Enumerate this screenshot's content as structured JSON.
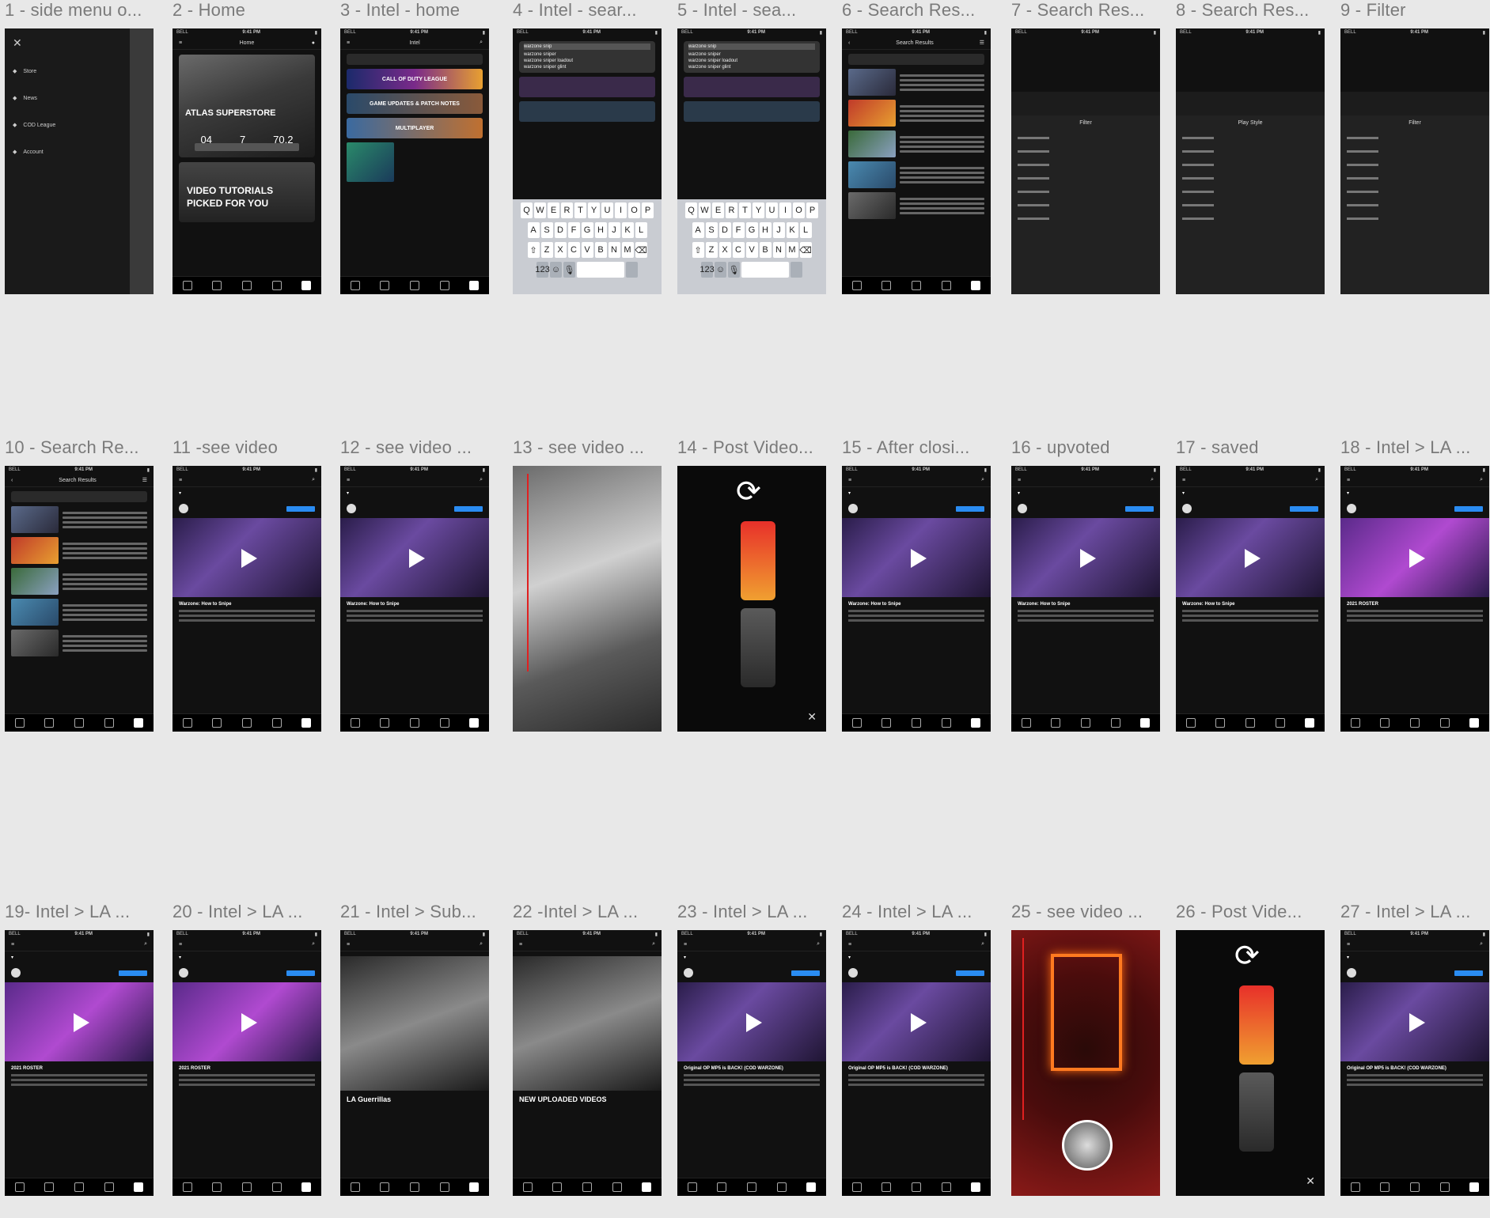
{
  "rows": [
    {
      "frames": [
        {
          "label": "1 - side menu o...",
          "kind": "menu",
          "menu_items": [
            "Store",
            "News",
            "COD League",
            "Account"
          ]
        },
        {
          "label": "2 - Home",
          "kind": "home",
          "title": "Home",
          "hero_title": "ATLAS SUPERSTORE",
          "stats": [
            "04",
            "7",
            "70.2"
          ],
          "card_title": "VIDEO TUTORIALS PICKED FOR YOU"
        },
        {
          "label": "3 - Intel -  home",
          "kind": "intel",
          "title": "Intel",
          "banners": [
            "CALL OF DUTY LEAGUE",
            "GAME UPDATES & PATCH NOTES",
            "MULTIPLAYER"
          ]
        },
        {
          "label": "4 - Intel - sear...",
          "kind": "search",
          "query": "warzone snip",
          "suggestions": [
            "warzone sniper",
            "warzone sniper loadout",
            "warzone sniper glint"
          ]
        },
        {
          "label": "5 -  Intel -  sea...",
          "kind": "search",
          "query": "warzone snip",
          "suggestions": [
            "warzone sniper",
            "warzone sniper loadout",
            "warzone sniper glint"
          ]
        },
        {
          "label": "6 - Search Res...",
          "kind": "results",
          "title": "Search Results"
        },
        {
          "label": "7 - Search Res...",
          "kind": "filter",
          "title": "Filter"
        },
        {
          "label": "8 - Search Res...",
          "kind": "filter",
          "title": "Play Style"
        },
        {
          "label": "9 - Filter",
          "kind": "filter",
          "title": "Filter"
        }
      ]
    },
    {
      "frames": [
        {
          "label": "10 - Search Re...",
          "kind": "results",
          "title": "Search Results"
        },
        {
          "label": "11 -see video",
          "kind": "video",
          "video_title": "Warzone: How to Snipe"
        },
        {
          "label": "12 - see video ...",
          "kind": "video",
          "video_title": "Warzone: How to Snipe"
        },
        {
          "label": "13 - see video ...",
          "kind": "fullimg"
        },
        {
          "label": "14 - Post Video...",
          "kind": "post"
        },
        {
          "label": "15 - After closi...",
          "kind": "video",
          "video_title": "Warzone: How to Snipe"
        },
        {
          "label": "16 - upvoted",
          "kind": "video",
          "video_title": "Warzone: How to Snipe"
        },
        {
          "label": "17 - saved",
          "kind": "video",
          "video_title": "Warzone: How to Snipe"
        },
        {
          "label": "18 - Intel > LA ...",
          "kind": "channel",
          "video_title": "2021 ROSTER"
        }
      ]
    },
    {
      "frames": [
        {
          "label": "19- Intel > LA ...",
          "kind": "channel",
          "video_title": "2021 ROSTER"
        },
        {
          "label": "20 - Intel > LA ...",
          "kind": "channel",
          "video_title": "2021 ROSTER"
        },
        {
          "label": "21 - Intel > Sub...",
          "kind": "subbed",
          "video_title": "LA Guerrillas"
        },
        {
          "label": "22 -Intel > LA ...",
          "kind": "subbed",
          "video_title": "NEW UPLOADED VIDEOS"
        },
        {
          "label": "23 - Intel > LA ...",
          "kind": "video",
          "video_title": "Original OP MP5 is BACK! (COD WARZONE)"
        },
        {
          "label": "24 - Intel > LA ...",
          "kind": "video",
          "video_title": "Original OP MP5 is BACK! (COD WARZONE)"
        },
        {
          "label": "25 - see video ...",
          "kind": "fire"
        },
        {
          "label": "26 - Post Vide...",
          "kind": "post"
        },
        {
          "label": "27 - Intel > LA ...",
          "kind": "video",
          "video_title": "Original OP MP5 is BACK! (COD WARZONE)"
        }
      ]
    }
  ],
  "status": {
    "carrier": "BELL",
    "time": "9:41 PM"
  }
}
